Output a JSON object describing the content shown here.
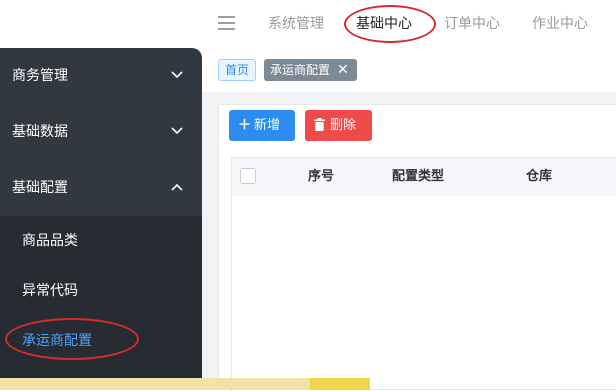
{
  "topbar": {
    "menu_icon": "hamburger-icon",
    "tabs": [
      {
        "label": "系统管理"
      },
      {
        "label": "基础中心"
      },
      {
        "label": "订单中心"
      },
      {
        "label": "作业中心"
      }
    ],
    "active_tab": "基础中心"
  },
  "sidebar": {
    "groups": [
      {
        "label": "商务管理",
        "icon": "chevron-down-icon"
      },
      {
        "label": "基础数据",
        "icon": "chevron-down-icon"
      },
      {
        "label": "基础配置",
        "icon": "chevron-up-icon"
      }
    ],
    "subitems": [
      {
        "label": "商品品类"
      },
      {
        "label": "异常代码"
      },
      {
        "label": "承运商配置"
      }
    ],
    "active_item": "承运商配置"
  },
  "breadcrumb": {
    "home": "首页",
    "current": "承运商配置",
    "close_icon": "close-icon"
  },
  "toolbar": {
    "add_label": "新增",
    "add_icon": "plus-icon",
    "delete_label": "删除",
    "delete_icon": "trash-icon"
  },
  "table": {
    "columns": [
      "序号",
      "配置类型",
      "仓库"
    ],
    "rows": []
  },
  "colors": {
    "sidebar_bg": "#31393f",
    "submenu_bg": "#262c31",
    "active_link": "#4da1ff",
    "primary": "#2d8cf0",
    "danger": "#ef4b4b",
    "annotation": "#d42c2c"
  }
}
